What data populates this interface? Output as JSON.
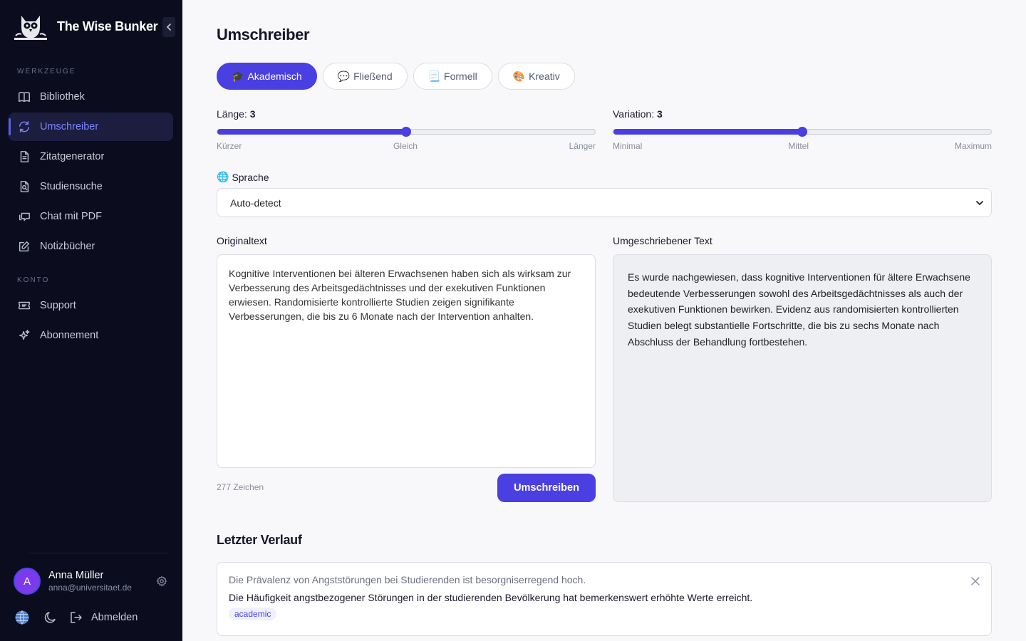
{
  "app": {
    "name": "The Wise Bunker"
  },
  "sidebar": {
    "sections": [
      {
        "label": "WERKZEUGE"
      },
      {
        "label": "KONTO"
      }
    ],
    "items": [
      {
        "label": "Bibliothek",
        "icon": "book-icon"
      },
      {
        "label": "Umschreiber",
        "icon": "refresh-icon",
        "active": true
      },
      {
        "label": "Zitatgenerator",
        "icon": "document-icon"
      },
      {
        "label": "Studiensuche",
        "icon": "file-search-icon"
      },
      {
        "label": "Chat mit PDF",
        "icon": "chat-icon"
      },
      {
        "label": "Notizbücher",
        "icon": "edit-icon"
      },
      {
        "label": "Support",
        "icon": "ticket-icon"
      },
      {
        "label": "Abonnement",
        "icon": "sparkles-icon"
      }
    ],
    "user": {
      "initial": "A",
      "name": "Anna Müller",
      "email": "anna@universitaet.de"
    },
    "logout_label": "Abmelden"
  },
  "main": {
    "title": "Umschreiber",
    "tabs": [
      {
        "emoji": "🎓",
        "label": "Akademisch",
        "active": true
      },
      {
        "emoji": "💬",
        "label": "Fließend"
      },
      {
        "emoji": "📃",
        "label": "Formell"
      },
      {
        "emoji": "🎨",
        "label": "Kreativ"
      }
    ],
    "length": {
      "label": "Länge:",
      "value": "3",
      "level": 0.5,
      "min_label": "Kürzer",
      "mid_label": "Gleich",
      "max_label": "Länger"
    },
    "variation": {
      "label": "Variation:",
      "value": "3",
      "level": 0.5,
      "min_label": "Minimal",
      "mid_label": "Mittel",
      "max_label": "Maximum"
    },
    "language": {
      "label": "Sprache",
      "emoji": "🌐",
      "selected": "Auto-detect"
    },
    "original": {
      "label": "Originaltext",
      "text": "Kognitive Interventionen bei älteren Erwachsenen haben sich als wirksam zur Verbesserung des Arbeitsgedächtnisses und der exekutiven Funktionen erwiesen. Randomisierte kontrollierte Studien zeigen signifikante Verbesserungen, die bis zu 6 Monate nach der Intervention anhalten.",
      "char_count": "277 Zeichen"
    },
    "rewritten": {
      "label": "Umgeschriebener Text",
      "text": "Es wurde nachgewiesen, dass kognitive Interventionen für ältere Erwachsene bedeutende Verbesserungen sowohl des Arbeitsgedächtnisses als auch der exekutiven Funktionen bewirken. Evidenz aus randomisierten kontrollierten Studien belegt substantielle Fortschritte, die bis zu sechs Monate nach Abschluss der Behandlung fortbestehen."
    },
    "submit_label": "Umschreiben",
    "history": {
      "title": "Letzter Verlauf",
      "entries": [
        {
          "original": "Die Prävalenz von Angststörungen bei Studierenden ist besorgniserregend hoch.",
          "rewritten": "Die Häufigkeit angstbezogener Störungen in der studierenden Bevölkerung hat bemerkenswert erhöhte Werte erreicht.",
          "tag": "academic"
        }
      ]
    }
  },
  "colors": {
    "accent": "#4a3fe0",
    "sidebar_bg": "#0b0d1f",
    "avatar": "#7c3aed"
  }
}
